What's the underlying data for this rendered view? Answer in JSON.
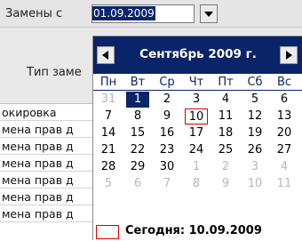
{
  "filter": {
    "label": "Замены с",
    "date_value": "01.09.2009"
  },
  "table": {
    "header_label": "Тип заме",
    "rows": [
      "окировка",
      "мена прав д",
      "мена прав д",
      "мена прав д",
      "мена прав д",
      "мена прав д",
      "мена прав д"
    ]
  },
  "calendar": {
    "month_title": "Сентябрь 2009 г.",
    "weekdays": [
      "Пн",
      "Вт",
      "Ср",
      "Чт",
      "Пт",
      "Сб",
      "Вс"
    ],
    "weeks": [
      [
        {
          "d": "31",
          "o": true
        },
        {
          "d": "1",
          "s": true
        },
        {
          "d": "2"
        },
        {
          "d": "3"
        },
        {
          "d": "4"
        },
        {
          "d": "5"
        },
        {
          "d": "6"
        }
      ],
      [
        {
          "d": "7"
        },
        {
          "d": "8"
        },
        {
          "d": "9"
        },
        {
          "d": "10",
          "t": true
        },
        {
          "d": "11"
        },
        {
          "d": "12"
        },
        {
          "d": "13"
        }
      ],
      [
        {
          "d": "14"
        },
        {
          "d": "15"
        },
        {
          "d": "16"
        },
        {
          "d": "17"
        },
        {
          "d": "18"
        },
        {
          "d": "19"
        },
        {
          "d": "20"
        }
      ],
      [
        {
          "d": "21"
        },
        {
          "d": "22"
        },
        {
          "d": "23"
        },
        {
          "d": "24"
        },
        {
          "d": "25"
        },
        {
          "d": "26"
        },
        {
          "d": "27"
        }
      ],
      [
        {
          "d": "28"
        },
        {
          "d": "29"
        },
        {
          "d": "30"
        },
        {
          "d": "1",
          "o": true
        },
        {
          "d": "2",
          "o": true
        },
        {
          "d": "3",
          "o": true
        },
        {
          "d": "4",
          "o": true
        }
      ],
      [
        {
          "d": "5",
          "o": true
        },
        {
          "d": "6",
          "o": true
        },
        {
          "d": "7",
          "o": true
        },
        {
          "d": "8",
          "o": true
        },
        {
          "d": "9",
          "o": true
        },
        {
          "d": "10",
          "o": true
        },
        {
          "d": "11",
          "o": true
        }
      ]
    ],
    "today_label": "Сегодня: 10.09.2009"
  },
  "colors": {
    "header_bg": "#0a246a",
    "selected_bg": "#0a246a",
    "today_border": "#d60000",
    "other_month_text": "#b8b8b8"
  },
  "icons": {
    "dropdown": "chevron-down-icon",
    "prev": "triangle-left-icon",
    "next": "triangle-right-icon"
  }
}
